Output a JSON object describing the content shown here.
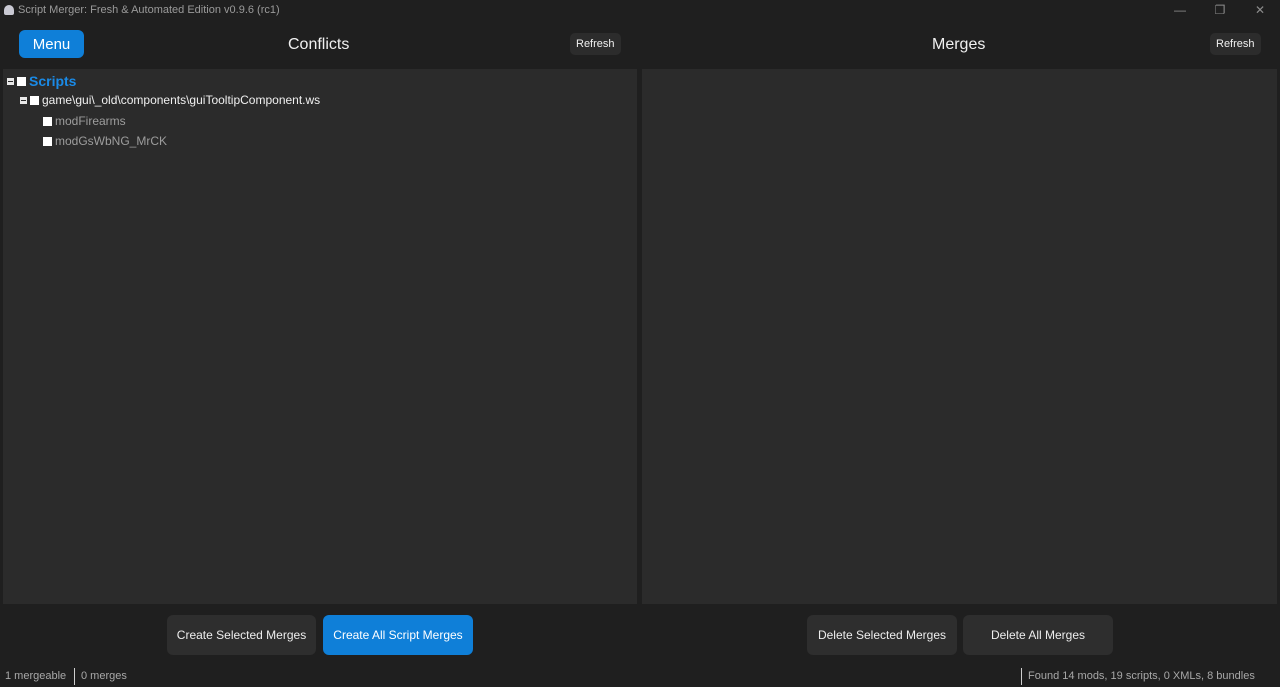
{
  "window": {
    "title": "Script Merger: Fresh & Automated Edition v0.9.6 (rc1)",
    "controls": {
      "minimize": "—",
      "restore": "❐",
      "close": "✕"
    }
  },
  "header": {
    "menu_label": "Menu",
    "conflicts_title": "Conflicts",
    "merges_title": "Merges",
    "refresh_label": "Refresh"
  },
  "conflicts": {
    "root": "Scripts",
    "file": "game\\gui\\_old\\components\\guiTooltipComponent.ws",
    "mods": [
      "modFirearms",
      "modGsWbNG_MrCK"
    ]
  },
  "buttons": {
    "create_selected": "Create Selected Merges",
    "create_all": "Create All Script Merges",
    "delete_selected": "Delete Selected Merges",
    "delete_all": "Delete All Merges"
  },
  "status": {
    "mergeable": "1 mergeable",
    "merges": "0 merges",
    "found": "Found 14 mods, 19 scripts, 0 XMLs, 8 bundles"
  },
  "colors": {
    "accent": "#0f7fd8",
    "background": "#1f1f1f",
    "panel": "#2b2b2b",
    "tree_root": "#1a8ae6"
  }
}
